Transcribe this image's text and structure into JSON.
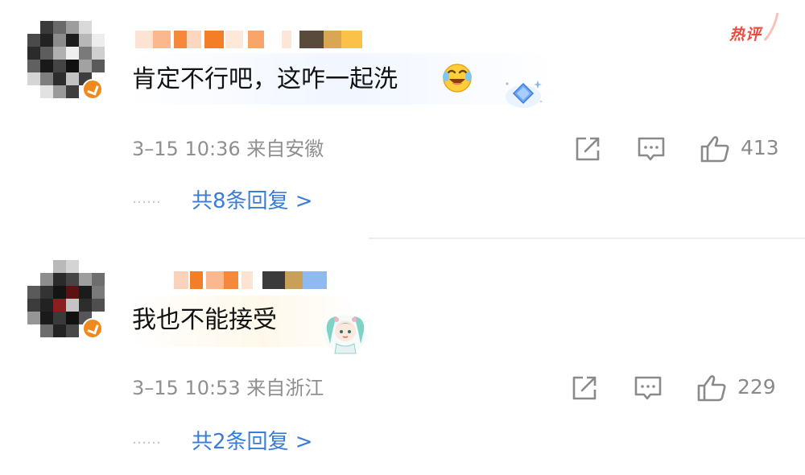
{
  "comments": [
    {
      "text": "肯定不行吧，这咋一起洗",
      "meta": "3–15 10:36 来自安徽",
      "likes": "413",
      "replies_dots": "……",
      "replies_link": "共8条回复 >",
      "badge": "热评",
      "inline_emoji": "laughing-crying-emoji",
      "decoration": "blue-diamond-sparkle"
    },
    {
      "text": "我也不能接受",
      "meta": "3–15 10:53 来自浙江",
      "likes": "229",
      "replies_dots": "……",
      "replies_link": "共2条回复 >",
      "decoration": "anime-character-sticker"
    }
  ],
  "icons": {
    "share": "share-icon",
    "reply": "comment-icon",
    "like": "thumbs-up-icon"
  },
  "colors": {
    "link": "#3b7dd6",
    "hot_badge": "#ea4b3d",
    "meta_text": "#8f8f8f",
    "avatar_badge": "#f08a1c"
  }
}
